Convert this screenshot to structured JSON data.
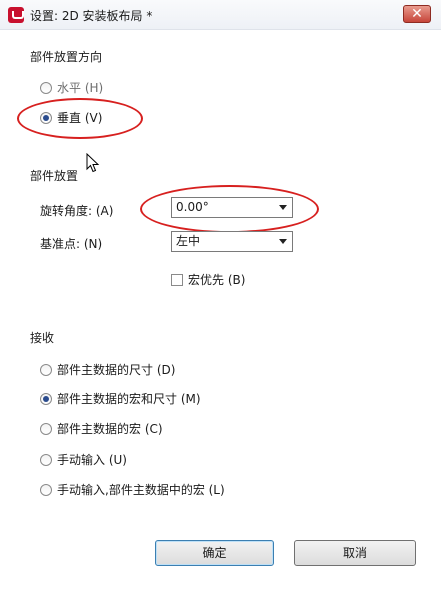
{
  "window": {
    "title": "设置: 2D 安装板布局 *",
    "close_glyph": "✕"
  },
  "orientation": {
    "heading": "部件放置方向",
    "options": [
      {
        "label": "水平 (H)",
        "checked": false
      },
      {
        "label": "垂直 (V)",
        "checked": true
      }
    ]
  },
  "placement": {
    "heading": "部件放置",
    "rotation_label": "旋转角度: (A)",
    "rotation_value": "0.00°",
    "anchor_label": "基准点: (N)",
    "anchor_value": "左中",
    "macro_first_label": "宏优先 (B)",
    "macro_first_checked": false
  },
  "receive": {
    "heading": "接收",
    "options": [
      {
        "label": "部件主数据的尺寸 (D)",
        "checked": false
      },
      {
        "label": "部件主数据的宏和尺寸 (M)",
        "checked": true
      },
      {
        "label": "部件主数据的宏 (C)",
        "checked": false
      },
      {
        "label": "手动输入  (U)",
        "checked": false
      },
      {
        "label": "手动输入,部件主数据中的宏 (L)",
        "checked": false
      }
    ]
  },
  "buttons": {
    "ok": "确定",
    "cancel": "取消"
  },
  "annotation_color": "#d7201f"
}
